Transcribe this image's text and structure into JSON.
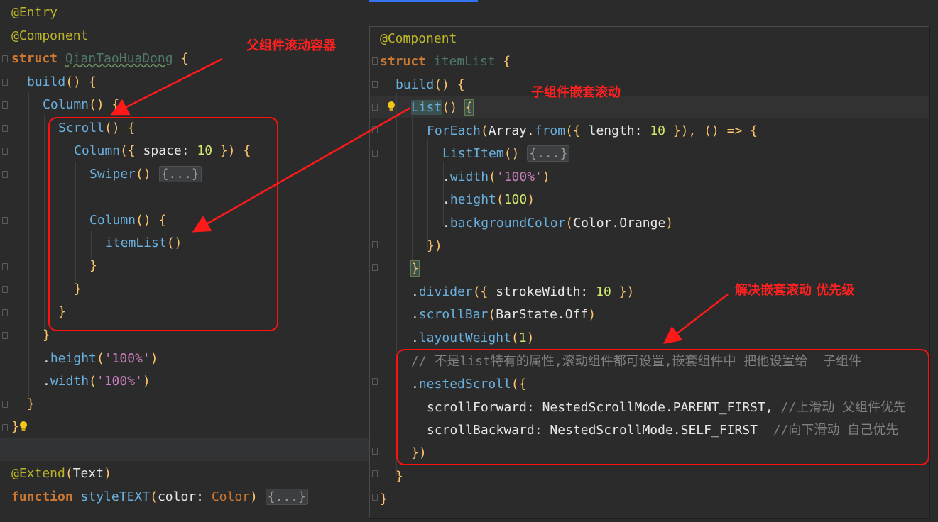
{
  "left_code": {
    "l1": "@Entry",
    "l2": "@Component",
    "l3_kw": "struct",
    "l3_name": "QianTaoHuaDong",
    "l3_brace": "{",
    "l4_fn": "build",
    "l4_rest": "() {",
    "l5_comp": "Column",
    "l5_rest": "() {",
    "l6_comp": "Scroll",
    "l6_rest": "() {",
    "l7_comp": "Column",
    "l7_a": "({",
    "l7_b": " space:",
    "l7_num": " 10",
    "l7_c": " }) {",
    "l8_comp": "Swiper",
    "l8_rest": "()",
    "l8_fold": "{...}",
    "l10_comp": "Column",
    "l10_rest": "() {",
    "l11_call": "itemList",
    "l11_rest": "()",
    "close": "}",
    "l17_dot": ".",
    "l17_prop": "height",
    "l17_str": "'100%'",
    "l18_prop": "width",
    "l18_str": "'100%'",
    "l21_close": "}",
    "l23_at": "@Extend",
    "l23_arg": "Text",
    "l24_kw": "function",
    "l24_fn": "styleTEXT",
    "l24_param": "color",
    "l24_type": "Color",
    "l24_fold": "{...}"
  },
  "right_code": {
    "r1": "@Component",
    "r2_kw": "struct",
    "r2_name": "itemList",
    "r2_brace": "{",
    "r3_fn": "build",
    "r3_rest": "() {",
    "r4_comp": "List",
    "r4_rest": "()",
    "r4_brace": "{",
    "r5_comp": "ForEach",
    "r5_a": "Array",
    "r5_from": "from",
    "r5_b": "length:",
    "r5_num": "10",
    "r5_c": "}), () => {",
    "r6_comp": "ListItem",
    "r6_rest": "()",
    "r6_fold": "{...}",
    "r7_prop": "width",
    "r7_str": "'100%'",
    "r8_prop": "height",
    "r8_num": "100",
    "r9_prop": "backgroundColor",
    "r9_arg": "Color.Orange",
    "r10": "})",
    "r11": "}",
    "r12_prop": "divider",
    "r12_arg": "strokeWidth:",
    "r12_num": "10",
    "r13_prop": "scrollBar",
    "r13_arg": "BarState.Off",
    "r14_prop": "layoutWeight",
    "r14_num": "1",
    "r15_comment": "// 不是list特有的属性,滚动组件都可设置,嵌套组件中 把他设置给  子组件",
    "r16_prop": "nestedScroll",
    "r17_key": "scrollForward:",
    "r17_val": "NestedScrollMode.PARENT_FIRST,",
    "r17_cmt": "//上滑动 父组件优先",
    "r18_key": "scrollBackward:",
    "r18_val": "NestedScrollMode.SELF_FIRST",
    "r18_cmt": "//向下滑动 自己优先",
    "r19": "})",
    "r20": "}",
    "r21": "}"
  },
  "annotations": {
    "parent": "父组件滚动容器",
    "child": "子组件嵌套滚动",
    "priority": "解决嵌套滚动  优先级"
  },
  "colors": {
    "annotation": "#ff2020",
    "background": "#2b2b2b",
    "keyword": "#cc7832",
    "annotation_tag": "#bbb529",
    "function": "#ffc66d",
    "number": "#6897bb",
    "string": "#9876aa",
    "comment": "#808080"
  }
}
